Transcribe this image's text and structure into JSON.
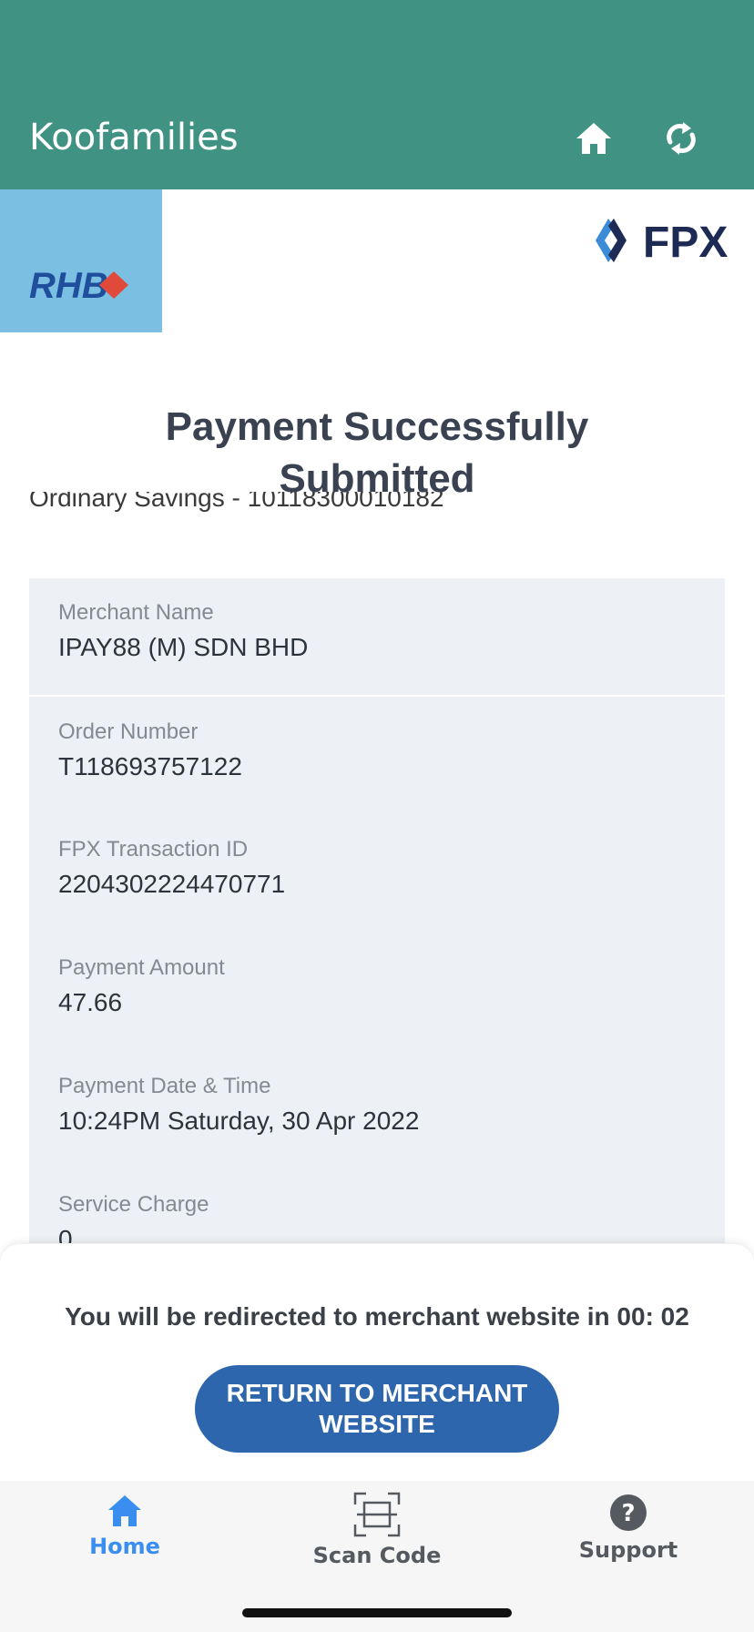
{
  "header": {
    "title": "Koofamilies",
    "icons": [
      "home-icon",
      "refresh-icon"
    ],
    "color": "#409282"
  },
  "bank": {
    "name": "RHB",
    "bg_color": "#7bbfe3"
  },
  "fpx_logo_text": "FPX",
  "status": {
    "title_line1": "Payment Successfully",
    "title_line2": "Submitted"
  },
  "account_line": "Ordinary Savings - 10118300010182",
  "details": [
    {
      "label": "Merchant Name",
      "value": "IPAY88 (M) SDN BHD"
    },
    {
      "label": "Order Number",
      "value": "T118693757122"
    },
    {
      "label": "FPX Transaction ID",
      "value": "2204302224470771"
    },
    {
      "label": "Payment Amount",
      "value": "47.66"
    },
    {
      "label": "Payment Date & Time",
      "value": "10:24PM Saturday, 30 Apr 2022"
    },
    {
      "label": "Service Charge",
      "value": "0"
    }
  ],
  "redirect": {
    "text": "You will be redirected to merchant website in 00: 02"
  },
  "return_button": {
    "line1": "RETURN TO MERCHANT",
    "line2": "WEBSITE",
    "color": "#2e66ae"
  },
  "tabs": [
    {
      "label": "Home",
      "icon": "home-icon",
      "active": true,
      "color": "#3a8ef0"
    },
    {
      "label": "Scan Code",
      "icon": "scan-icon",
      "active": false
    },
    {
      "label": "Support",
      "icon": "help-icon",
      "active": false
    }
  ]
}
